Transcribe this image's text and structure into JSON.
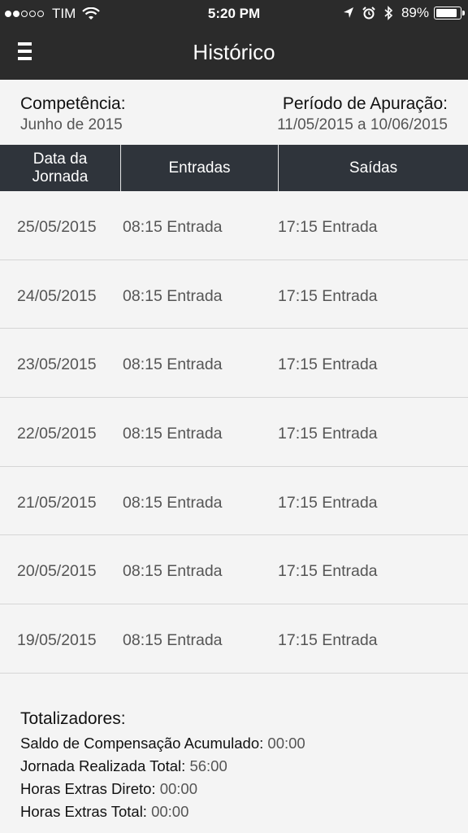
{
  "status_bar": {
    "carrier": "TIM",
    "time": "5:20 PM",
    "battery_percent": "89%",
    "battery_level": 0.89,
    "signal_bars_filled": 2,
    "signal_bars_total": 5,
    "icons": [
      "wifi-icon",
      "location-arrow-icon",
      "alarm-icon",
      "bluetooth-icon",
      "battery-icon"
    ]
  },
  "navbar": {
    "title": "Histórico",
    "menu_icon": "hamburger-menu-icon"
  },
  "info": {
    "competencia_label": "Competência:",
    "competencia_value": "Junho de 2015",
    "periodo_label": "Período de Apuração:",
    "periodo_value": "11/05/2015 a 10/06/2015"
  },
  "table": {
    "headers": [
      "Data da\nJornada",
      "Entradas",
      "Saídas"
    ],
    "rows": [
      {
        "date": "25/05/2015",
        "entrada": "08:15 Entrada",
        "saida": "17:15 Entrada"
      },
      {
        "date": "24/05/2015",
        "entrada": "08:15 Entrada",
        "saida": "17:15 Entrada"
      },
      {
        "date": "23/05/2015",
        "entrada": "08:15 Entrada",
        "saida": "17:15 Entrada"
      },
      {
        "date": "22/05/2015",
        "entrada": "08:15 Entrada",
        "saida": "17:15 Entrada"
      },
      {
        "date": "21/05/2015",
        "entrada": "08:15 Entrada",
        "saida": "17:15 Entrada"
      },
      {
        "date": "20/05/2015",
        "entrada": "08:15 Entrada",
        "saida": "17:15 Entrada"
      },
      {
        "date": "19/05/2015",
        "entrada": "08:15 Entrada",
        "saida": "17:15 Entrada"
      }
    ]
  },
  "totals": {
    "title": "Totalizadores:",
    "items": [
      {
        "label": "Saldo de Compensação Acumulado: ",
        "value": "00:00"
      },
      {
        "label": "Jornada Realizada Total: ",
        "value": "56:00"
      },
      {
        "label": "Horas Extras Direto: ",
        "value": "00:00"
      },
      {
        "label": "Horas Extras Total: ",
        "value": "00:00"
      }
    ]
  },
  "colors": {
    "navbar_bg": "#2b2b2b",
    "table_header_bg": "#2f343b",
    "page_bg": "#f4f4f4"
  }
}
